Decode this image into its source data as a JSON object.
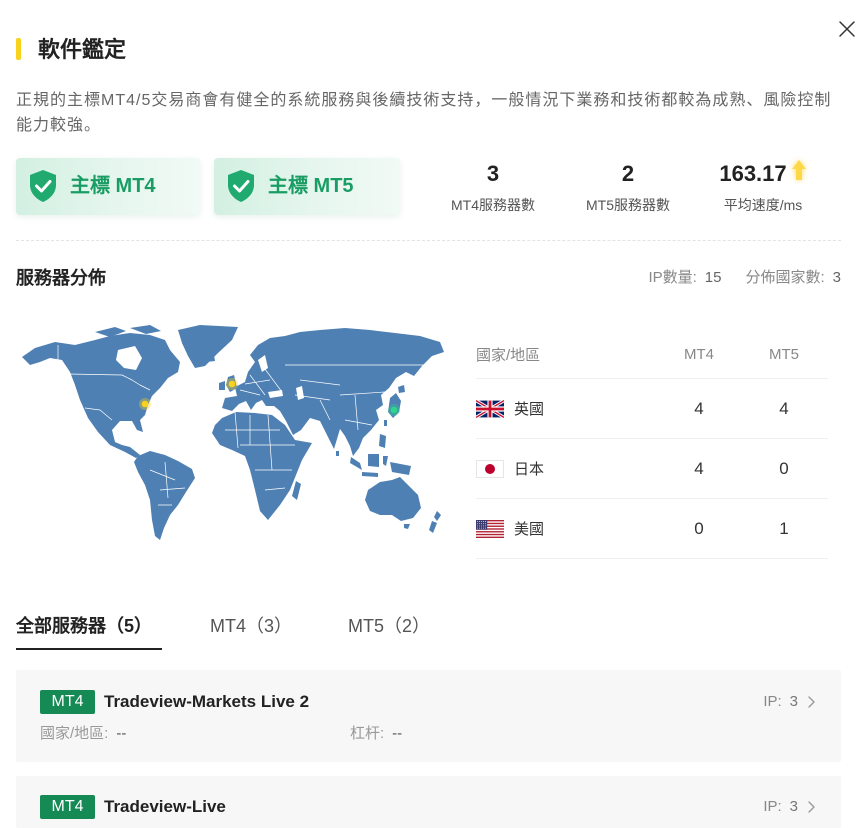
{
  "header": {
    "title": "軟件鑑定",
    "description": "正規的主標MT4/5交易商會有健全的系統服務與後續技術支持，一般情況下業務和技術都較為成熟、風險控制能力較強。"
  },
  "badges": [
    {
      "icon": "shield-check",
      "label": "主標 MT4"
    },
    {
      "icon": "shield-check",
      "label": "主標 MT5"
    }
  ],
  "stats": [
    {
      "value": "3",
      "label": "MT4服務器數"
    },
    {
      "value": "2",
      "label": "MT5服務器數"
    },
    {
      "value": "163.17",
      "label": "平均速度/ms",
      "icon": "speed-up-arrow"
    }
  ],
  "distribution": {
    "title": "服務器分佈",
    "ip_count_label": "IP數量:",
    "ip_count": "15",
    "country_count_label": "分佈國家數:",
    "country_count": "3",
    "table": {
      "headers": [
        "國家/地區",
        "MT4",
        "MT5"
      ],
      "rows": [
        {
          "flag": "uk-flag",
          "country": "英國",
          "mt4": "4",
          "mt5": "4"
        },
        {
          "flag": "japan-flag",
          "country": "日本",
          "mt4": "4",
          "mt5": "0"
        },
        {
          "flag": "us-flag",
          "country": "美國",
          "mt4": "0",
          "mt5": "1"
        }
      ]
    }
  },
  "map": {
    "marker_colors": [
      "#f8d21c",
      "#f8d21c",
      "#2fd58b"
    ]
  },
  "tabs": [
    {
      "label": "全部服務器（5）",
      "active": true
    },
    {
      "label": "MT4（3）",
      "active": false
    },
    {
      "label": "MT5（2）",
      "active": false
    }
  ],
  "servers": [
    {
      "platform": "MT4",
      "name": "Tradeview-Markets Live 2",
      "ip_label": "IP:",
      "ip_count": "3",
      "country_label": "國家/地區:",
      "country": "--",
      "leverage_label": "杠杆:",
      "leverage": "--"
    },
    {
      "platform": "MT4",
      "name": "Tradeview-Live",
      "ip_label": "IP:",
      "ip_count": "3"
    }
  ],
  "colors": {
    "accent": "#f8d21c",
    "badge_text": "#1a9d65",
    "shield": "#20aa6f",
    "platform_badge": "#158a55",
    "map_fill": "#4f80b4",
    "speed_arrow": "#ffd84a"
  }
}
